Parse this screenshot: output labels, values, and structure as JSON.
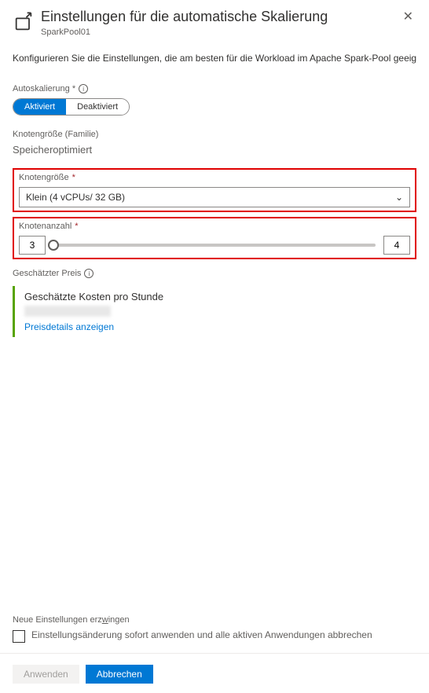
{
  "header": {
    "title": "Einstellungen für die automatische Skalierung",
    "subtitle": "SparkPool01"
  },
  "description": "Konfigurieren Sie die Einstellungen, die am besten für die Workload im Apache Spark-Pool geeignet sind.",
  "autoscale": {
    "label": "Autoskalierung *",
    "enabled": "Aktiviert",
    "disabled": "Deaktiviert"
  },
  "nodeFamily": {
    "label": "Knotengröße (Familie)",
    "value": "Speicheroptimiert"
  },
  "nodeSize": {
    "label": "Knotengröße",
    "value": "Klein (4 vCPUs/    32 GB)"
  },
  "nodeCount": {
    "label": "Knotenanzahl",
    "min": "3",
    "max": "4"
  },
  "price": {
    "label": "Geschätzter Preis",
    "title": "Geschätzte Kosten pro Stunde",
    "link": "Preisdetails anzeigen"
  },
  "force": {
    "label": "Neue Einstellungen erzwingen",
    "checkbox": "Einstellungsänderung sofort anwenden und alle aktiven Anwendungen abbrechen"
  },
  "footer": {
    "apply": "Anwenden",
    "cancel": "Abbrechen"
  }
}
